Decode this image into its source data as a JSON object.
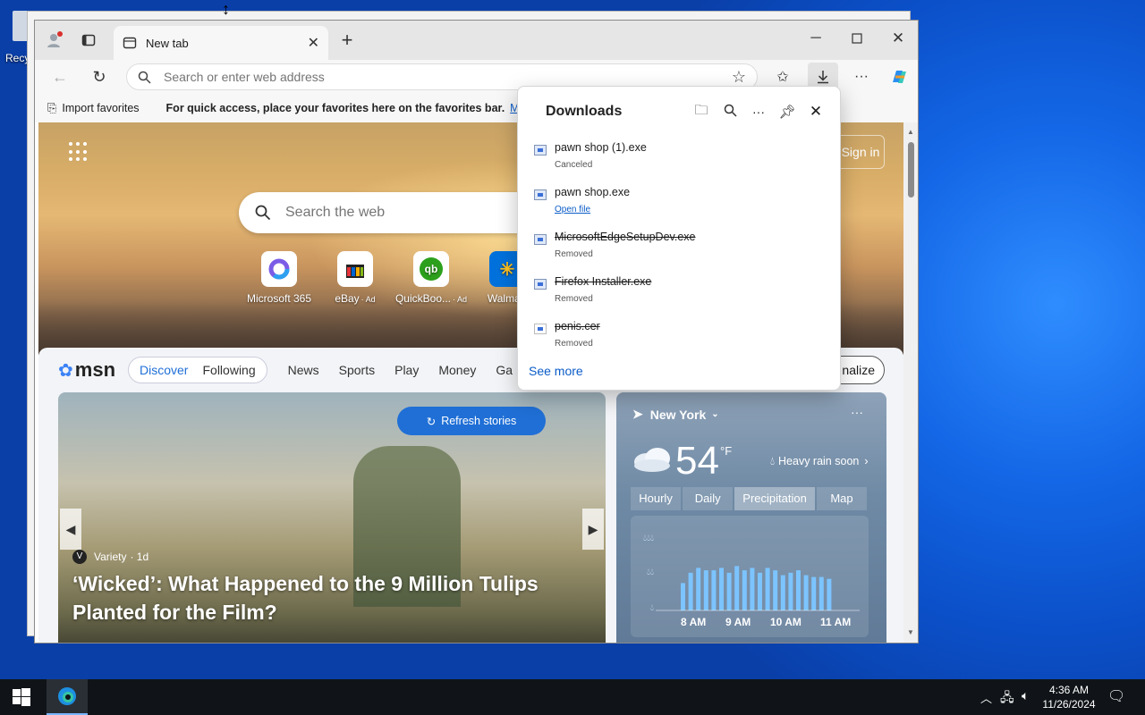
{
  "desktop": {
    "icon_label": "Recy"
  },
  "browser": {
    "tab_title": "New tab",
    "address_placeholder": "Search or enter web address",
    "favorites_bar": {
      "import_label": "Import favorites",
      "hint": "For quick access, place your favorites here on the favorites bar.",
      "manage_link": "Manage"
    }
  },
  "newtab": {
    "search_placeholder": "Search the web",
    "sign_in": "Sign in",
    "quick_links": [
      {
        "label": "Microsoft 365",
        "ad": ""
      },
      {
        "label": "eBay",
        "ad": "· Ad"
      },
      {
        "label": "QuickBoo...",
        "ad": "· Ad"
      },
      {
        "label": "Walmart",
        "ad": ""
      }
    ],
    "msn": {
      "logo": "msn",
      "tabs": [
        "Discover",
        "Following"
      ],
      "nav": [
        "News",
        "Sports",
        "Play",
        "Money",
        "Ga"
      ],
      "personalize": "nalize"
    },
    "story": {
      "refresh": "Refresh stories",
      "source": "Variety",
      "age": "· 1d",
      "headline": "‘Wicked’: What Happened to the 9 Million Tulips Planted for the Film?"
    },
    "weather": {
      "location": "New York",
      "temperature": "54",
      "unit": "°F",
      "alert": "Heavy rain soon",
      "tabs": [
        "Hourly",
        "Daily",
        "Precipitation",
        "Map"
      ],
      "selected_tab": "Precipitation",
      "time_labels": [
        "8 AM",
        "9 AM",
        "10 AM",
        "11 AM"
      ],
      "precip_bars": [
        0.45,
        0.62,
        0.7,
        0.66,
        0.66,
        0.7,
        0.62,
        0.73,
        0.66,
        0.7,
        0.62,
        0.7,
        0.66,
        0.58,
        0.62,
        0.66,
        0.58,
        0.55,
        0.55,
        0.52
      ]
    }
  },
  "downloads": {
    "title": "Downloads",
    "items": [
      {
        "name": "pawn shop (1).exe",
        "status": "Canceled",
        "removed": false,
        "link": false
      },
      {
        "name": "pawn shop.exe",
        "status": "Open file",
        "removed": false,
        "link": true
      },
      {
        "name": "MicrosoftEdgeSetupDev.exe",
        "status": "Removed",
        "removed": true,
        "link": false
      },
      {
        "name": "Firefox Installer.exe",
        "status": "Removed",
        "removed": true,
        "link": false
      },
      {
        "name": "penis.cer",
        "status": "Removed",
        "removed": true,
        "link": false
      }
    ],
    "see_more": "See more"
  },
  "taskbar": {
    "time": "4:36 AM",
    "date": "11/26/2024"
  }
}
